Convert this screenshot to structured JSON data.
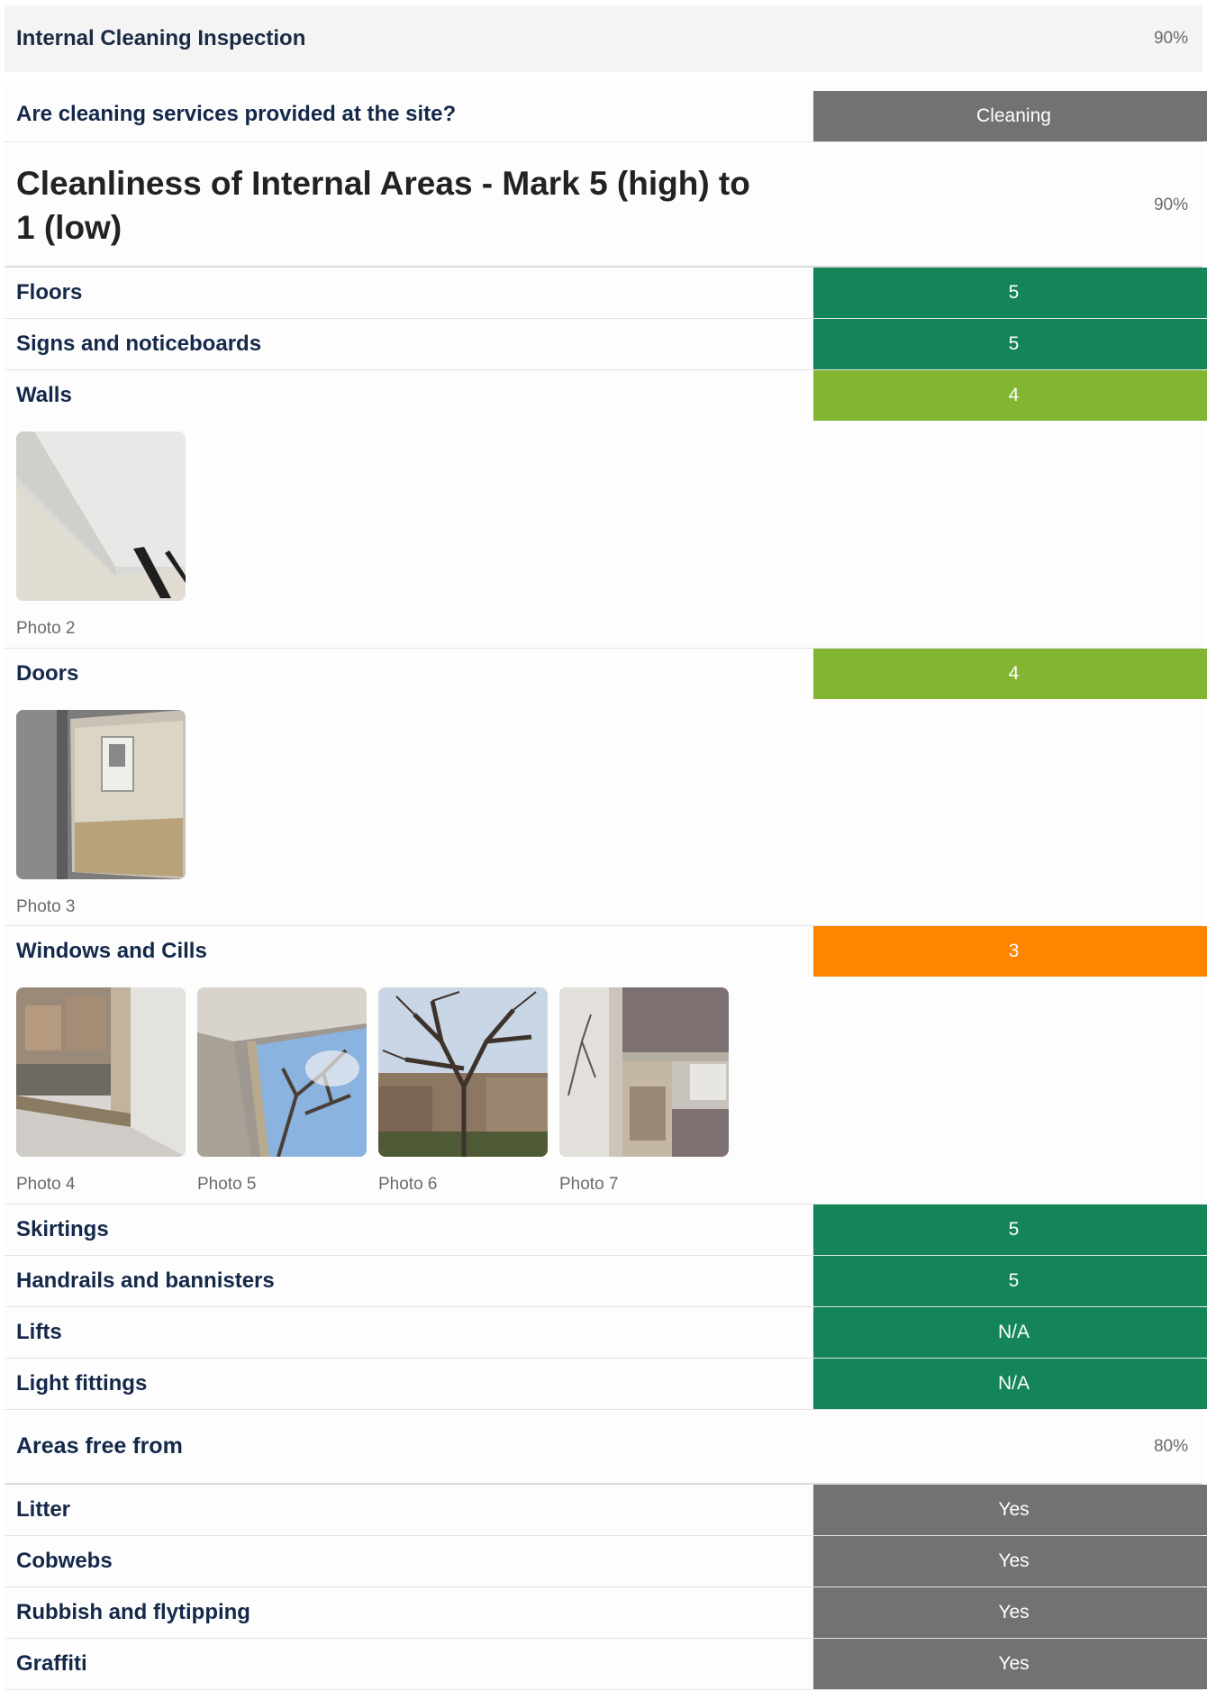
{
  "header": {
    "title": "Internal Cleaning Inspection",
    "score": "90%"
  },
  "services": {
    "question": "Are cleaning services provided at the site?",
    "answer": "Cleaning"
  },
  "cleanliness": {
    "title": "Cleanliness of Internal Areas - Mark 5 (high) to 1 (low)",
    "score": "90%",
    "items": [
      {
        "label": "Floors",
        "value": "5"
      },
      {
        "label": "Signs and noticeboards",
        "value": "5"
      },
      {
        "label": "Walls",
        "value": "4",
        "photos": [
          "Photo 2"
        ]
      },
      {
        "label": "Doors",
        "value": "4",
        "photos": [
          "Photo 3"
        ]
      },
      {
        "label": "Windows and Cills",
        "value": "3",
        "photos": [
          "Photo 4",
          "Photo 5",
          "Photo 6",
          "Photo 7"
        ]
      },
      {
        "label": "Skirtings",
        "value": "5"
      },
      {
        "label": "Handrails and bannisters",
        "value": "5"
      },
      {
        "label": "Lifts",
        "value": "N/A"
      },
      {
        "label": "Light fittings",
        "value": "N/A"
      }
    ]
  },
  "free_from": {
    "title": "Areas free from",
    "score": "80%",
    "items": [
      {
        "label": "Litter",
        "value": "Yes"
      },
      {
        "label": "Cobwebs",
        "value": "Yes"
      },
      {
        "label": "Rubbish and flytipping",
        "value": "Yes"
      },
      {
        "label": "Graffiti",
        "value": "Yes"
      }
    ]
  },
  "colors": {
    "green": "#148558",
    "lime": "#82b532",
    "orange": "#ff8500",
    "grey": "#727272"
  }
}
